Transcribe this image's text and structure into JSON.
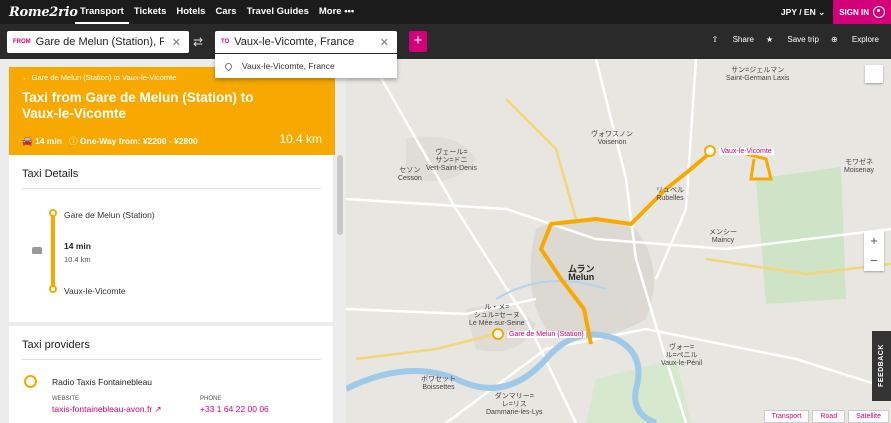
{
  "brand": {
    "logo": "Rome2rio",
    "accent": "#d4007a",
    "taxi_color": "#f7a900"
  },
  "nav": {
    "items": [
      "Transport",
      "Tickets",
      "Hotels",
      "Cars",
      "Travel Guides",
      "More •••"
    ],
    "currency_lang": "JPY / EN ⌄",
    "signin": "SIGN IN"
  },
  "search": {
    "from_tag": "FROM",
    "from_value": "Gare de Melun (Station), Fran",
    "to_tag": "TO",
    "to_value": "Vaux-le-Vicomte, France",
    "suggestion": "Vaux-le-Vicomte, France",
    "share": "Share",
    "save": "Save trip",
    "explore": "Explore"
  },
  "route": {
    "breadcrumb": "Gare de Melun (Station) to Vaux-le-Vicomte",
    "title": "Taxi from Gare de Melun (Station) to Vaux-le-Vicomte",
    "duration": "14 min",
    "price": "One-Way from: ¥2200 - ¥2800",
    "distance": "10.4 km"
  },
  "details": {
    "heading": "Taxi Details",
    "origin": "Gare de Melun (Station)",
    "duration": "14 min",
    "distance": "10.4 km",
    "destination": "Vaux-le-Vicomte"
  },
  "providers": {
    "heading": "Taxi providers",
    "name": "Radio Taxis Fontainebleau",
    "website_label": "WEBSITE",
    "website": "taxis-fontainebleau-avon.fr ↗",
    "phone_label": "PHONE",
    "phone": "+33 1 64 22 00 06"
  },
  "map": {
    "marker_start": "Gare de Melun (Station)",
    "marker_end": "Vaux-le-Vicomte",
    "towns": [
      {
        "name": "ムラン\nMelun"
      },
      {
        "name": "ヴォー=\nル=ペニル\nVaux-le-Pénil"
      },
      {
        "name": "ヴェール=\nサン=ドニ\nVert-Saint-Denis"
      },
      {
        "name": "セソン\nCesson"
      },
      {
        "name": "ヴォワスノン\nVoisenon"
      },
      {
        "name": "サン=ジェルマン\nSaint-Germain Laxis"
      },
      {
        "name": "メンシー\nMaincy"
      },
      {
        "name": "ル・メ=\nシュル=セーヌ\nLe Mée-sur-Seine"
      },
      {
        "name": "ボワセット\nBoissettes"
      },
      {
        "name": "ダンマリー=\nレ=リス\nDammarie-les-Lys"
      },
      {
        "name": "モワゼネ\nMoisenay"
      },
      {
        "name": "リュベル\nRubelles"
      }
    ],
    "tabs": [
      "Transport",
      "Road",
      "Satellite"
    ],
    "feedback": "FEEDBACK"
  }
}
